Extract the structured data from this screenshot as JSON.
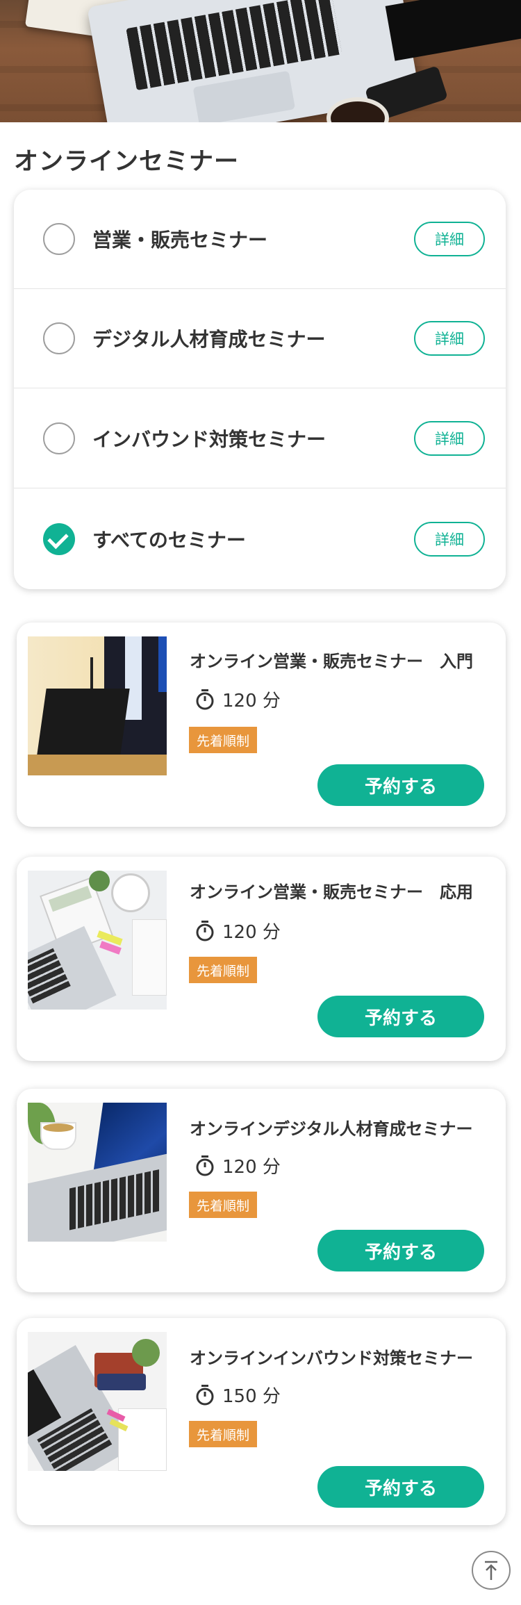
{
  "page_title": "オンラインセミナー",
  "filter": {
    "detail_label": "詳細",
    "items": [
      {
        "label": "営業・販売セミナー",
        "checked": false
      },
      {
        "label": "デジタル人材育成セミナー",
        "checked": false
      },
      {
        "label": "インバウンド対策セミナー",
        "checked": false
      },
      {
        "label": "すべてのセミナー",
        "checked": true
      }
    ]
  },
  "seminars": [
    {
      "title": "オンライン営業・販売セミナー　入門",
      "duration": "120 分",
      "badge": "先着順制",
      "button": "予約する",
      "thumb_icon": "lecture-photo"
    },
    {
      "title": "オンライン営業・販売セミナー　応用",
      "duration": "120 分",
      "badge": "先着順制",
      "button": "予約する",
      "thumb_icon": "desk-calculator-photo"
    },
    {
      "title": "オンラインデジタル人材育成セミナー",
      "duration": "120 分",
      "badge": "先着順制",
      "button": "予約する",
      "thumb_icon": "laptop-tea-photo"
    },
    {
      "title": "オンラインインバウンド対策セミナー",
      "duration": "150 分",
      "badge": "先着順制",
      "button": "予約する",
      "thumb_icon": "laptop-stationery-photo"
    }
  ],
  "colors": {
    "accent": "#10b294",
    "badge": "#e8963c",
    "text": "#333333"
  },
  "icons": {
    "timer": "stopwatch-icon",
    "check": "check-icon",
    "back_to_top": "arrow-up-icon"
  }
}
